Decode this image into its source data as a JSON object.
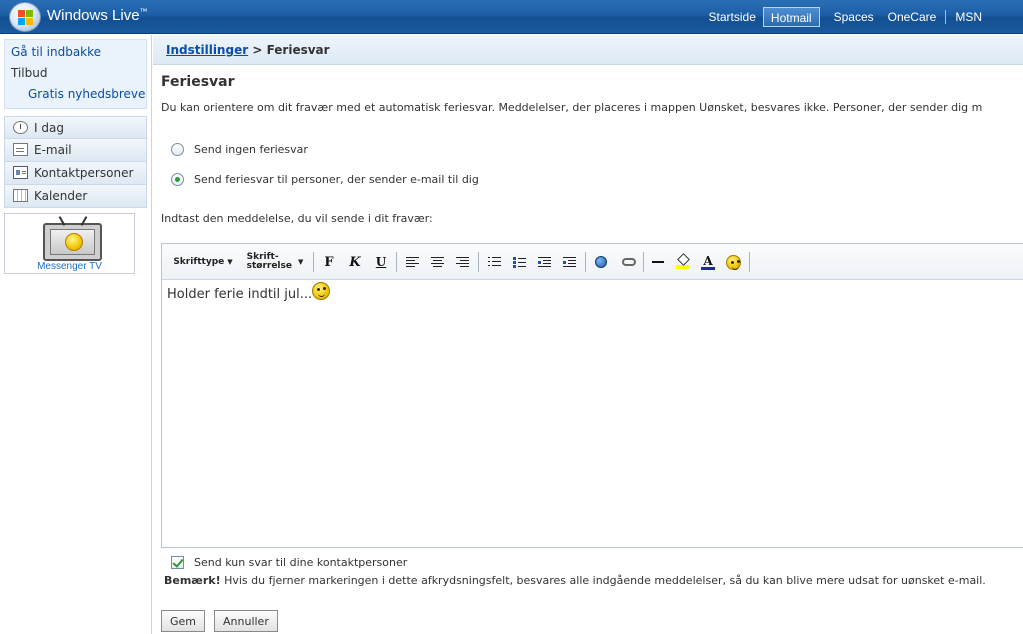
{
  "header": {
    "brand": "Windows Live",
    "brand_mark": "™",
    "nav": [
      "Startside",
      "Hotmail",
      "Spaces",
      "OneCare",
      "MSN"
    ],
    "active_nav": "Hotmail"
  },
  "sidebar": {
    "links": [
      "Gå til indbakke",
      "Tilbud",
      "Gratis nyhedsbreve"
    ],
    "nav": [
      {
        "label": "I dag",
        "icon": "clock-icon"
      },
      {
        "label": "E-mail",
        "icon": "mail-icon"
      },
      {
        "label": "Kontaktpersoner",
        "icon": "contacts-icon"
      },
      {
        "label": "Kalender",
        "icon": "calendar-icon"
      }
    ],
    "promo_label": "Messenger TV"
  },
  "breadcrumb": {
    "parent": "Indstillinger",
    "separator": ">",
    "current": "Feriesvar"
  },
  "page": {
    "title": "Feriesvar",
    "intro": "Du kan orientere om dit fravær med et automatisk feriesvar. Meddelelser, der placeres i mappen Uønsket, besvares ikke. Personer, der sender dig m",
    "options": [
      {
        "label": "Send ingen feriesvar",
        "checked": false
      },
      {
        "label": "Send feriesvar til personer, der sender e-mail til dig",
        "checked": true
      }
    ],
    "prompt": "Indtast den meddelelse, du vil sende i dit fravær:"
  },
  "toolbar": {
    "font_label": "Skrifttype",
    "size_label_1": "Skrift-",
    "size_label_2": "størrelse",
    "bold": "F",
    "italic": "K",
    "underline": "U"
  },
  "editor": {
    "text": "Holder ferie indtil jul..."
  },
  "contacts_only": {
    "label": "Send kun svar til dine kontaktpersoner",
    "checked": true
  },
  "note": {
    "bold": "Bemærk!",
    "text": " Hvis du fjerner markeringen i dette afkrydsningsfelt, besvares alle indgående meddelelser, så du kan blive mere udsat for uønsket e-mail."
  },
  "buttons": {
    "save": "Gem",
    "cancel": "Annuller"
  },
  "colors": {
    "header_blue": "#1d5ea6",
    "link_blue": "#0c4ea2",
    "check_green": "#2d9a3c"
  }
}
